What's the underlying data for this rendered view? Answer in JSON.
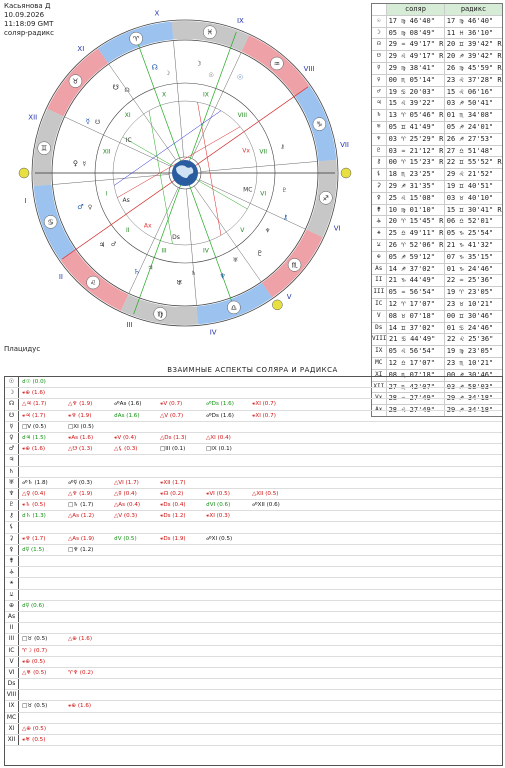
{
  "header": {
    "name": "Касьянова Д",
    "date": "10.09.2026",
    "time": "11:18:09 GMT",
    "chart_type": "соляр-радикс"
  },
  "house_system": "Плацидус",
  "colors": {
    "houses_arc_blue": "#4a90e2",
    "houses_arc_red": "#e05560",
    "houses_arc_gray": "#999999",
    "sun_marker": "#e8e040",
    "globe": "#2a5d9f"
  },
  "wheel": {
    "house_numerals_outer": [
      "I",
      "II",
      "III",
      "IV",
      "V",
      "VI",
      "VII",
      "VIII",
      "IX",
      "X",
      "XI",
      "XII",
      "Vx"
    ],
    "house_numerals_inner": [
      "I",
      "II",
      "III",
      "IV",
      "V",
      "VI",
      "VII",
      "VIII",
      "IX",
      "X",
      "XI",
      "XII"
    ],
    "axes": {
      "asc": "As",
      "ds": "Ds",
      "mc": "MC",
      "ic": "IC",
      "vx": "Vx",
      "ax": "Ax"
    },
    "zodiac_glyphs": [
      "♑",
      "♒",
      "♓",
      "♈",
      "♉",
      "♊",
      "♋",
      "♌",
      "♍",
      "♎",
      "♏",
      "♐"
    ]
  },
  "planets_table": {
    "headers": [
      "",
      "соляр",
      "радикс"
    ],
    "rows": [
      [
        "☉",
        "17 ♍ 46'40\"",
        "17 ♍ 46'40\""
      ],
      [
        "☽",
        "05 ♍ 08'49\"",
        "11 ♓ 36'10\""
      ],
      [
        "☊",
        "29 ♒ 49'17\" R",
        "20 ♊ 39'42\" R"
      ],
      [
        "☋",
        "29 ♌ 49'17\" R",
        "20 ♐ 39'42\" R"
      ],
      [
        "☿",
        "29 ♍ 38'41\"",
        "26 ♍ 45'59\" R"
      ],
      [
        "♀",
        "00 ♏ 05'14\"",
        "23 ♌ 37'28\" R"
      ],
      [
        "♂",
        "19 ♋ 20'03\"",
        "15 ♌ 06'16\""
      ],
      [
        "♃",
        "15 ♌ 39'22\"",
        "03 ♐ 50'41\""
      ],
      [
        "♄",
        "13 ♈ 05'46\" R",
        "01 ♏ 34'08\""
      ],
      [
        "♅",
        "05 ♊ 41'49\"",
        "05 ♐ 24'01\""
      ],
      [
        "♆",
        "03 ♈ 25'29\" R",
        "26 ♐ 27'53\""
      ],
      [
        "♇",
        "03 ♒ 21'12\" R",
        "27 ♎ 51'48\""
      ],
      [
        "⚷",
        "00 ♈ 15'23\" R",
        "22 ♊ 55'52\" R"
      ],
      [
        "⚸",
        "18 ♏ 23'25\"",
        "29 ♌ 21'52\""
      ],
      [
        "⚳",
        "29 ♐ 31'35\"",
        "19 ♊ 40'51\""
      ],
      [
        "⚴",
        "25 ♌ 15'08\"",
        "03 ♉ 40'10\""
      ],
      [
        "⚵",
        "10 ♍ 01'10\"",
        "15 ♊ 30'41\" R"
      ],
      [
        "⚶",
        "20 ♈ 15'45\" R",
        "06 ♎ 52'01\""
      ],
      [
        "⚹",
        "25 ♎ 49'11\" R",
        "05 ♑ 25'54\""
      ],
      [
        "⚺",
        "26 ♈ 52'06\" R",
        "21 ♑ 41'32\""
      ],
      [
        "⊕",
        "05 ♐ 59'12\"",
        "07 ♑ 35'15\""
      ],
      [
        "As",
        "14 ♐ 37'02\"",
        "01 ♑ 24'46\""
      ],
      [
        "II",
        "21 ♑ 44'49\"",
        "22 ♒ 25'36\""
      ],
      [
        "III",
        "05 ♒ 56'54\"",
        "19 ♈ 23'05\""
      ],
      [
        "IC",
        "12 ♈ 17'07\"",
        "23 ♉ 10'21\""
      ],
      [
        "V",
        "08 ♉ 07'18\"",
        "00 ♊ 30'46\""
      ],
      [
        "Ds",
        "14 ♊ 37'02\"",
        "01 ♋ 24'46\""
      ],
      [
        "VIII",
        "21 ♋ 44'49\"",
        "22 ♌ 25'36\""
      ],
      [
        "IX",
        "05 ♌ 56'54\"",
        "19 ♍ 23'05\""
      ],
      [
        "MC",
        "12 ♎ 17'07\"",
        "23 ♏ 10'21\""
      ],
      [
        "XI",
        "08 ♏ 07'18\"",
        "00 ♐ 30'46\""
      ],
      [
        "XII",
        "27 ♏ 42'07\"",
        "03 ♐ 58'03\""
      ],
      [
        "Vx",
        "28 ♒ 27'49\"",
        "29 ♐ 34'18\""
      ],
      [
        "Ax",
        "28 ♌ 27'49\"",
        "29 ♐ 34'18\""
      ]
    ]
  },
  "aspects_title": "ВЗАИМНЫЕ АСПЕКТЫ СОЛЯРА И РАДИКСА",
  "aspects": [
    {
      "label": "☉",
      "cells": [
        {
          "t": "☌☉ (0.0)",
          "c": "green"
        }
      ]
    },
    {
      "label": "☽",
      "cells": [
        {
          "t": "⚹⊕ (1.6)",
          "c": "red"
        }
      ]
    },
    {
      "label": "☊",
      "cells": [
        {
          "t": "△♃ (1.7)",
          "c": "red"
        },
        {
          "t": "△♆ (1.9)",
          "c": "red"
        },
        {
          "t": "☍As (1.6)",
          "c": "black"
        },
        {
          "t": "⚹V (0.7)",
          "c": "red"
        },
        {
          "t": "☍Ds (1.6)",
          "c": "green"
        },
        {
          "t": "⚹XI (0.7)",
          "c": "red"
        }
      ]
    },
    {
      "label": "☋",
      "cells": [
        {
          "t": "⚹♃ (1.7)",
          "c": "red"
        },
        {
          "t": "⚹♆ (1.9)",
          "c": "red"
        },
        {
          "t": "☌As (1.6)",
          "c": "green"
        },
        {
          "t": "△V (0.7)",
          "c": "red"
        },
        {
          "t": "☍Ds (1.6)",
          "c": "black"
        },
        {
          "t": "⚹XI (0.7)",
          "c": "red"
        }
      ]
    },
    {
      "label": "☿",
      "cells": [
        {
          "t": "□V (0.5)",
          "c": "black"
        },
        {
          "t": "□XI (0.5)",
          "c": "black"
        }
      ]
    },
    {
      "label": "♀",
      "cells": [
        {
          "t": "☌♃ (1.5)",
          "c": "green"
        },
        {
          "t": "⚹As (1.6)",
          "c": "red"
        },
        {
          "t": "⚹V (0.4)",
          "c": "red"
        },
        {
          "t": "△Ds (1.3)",
          "c": "red"
        },
        {
          "t": "△XI (0.4)",
          "c": "red"
        }
      ]
    },
    {
      "label": "♂",
      "cells": [
        {
          "t": "⚹⊕ (1.6)",
          "c": "red"
        },
        {
          "t": "△☋ (1.3)",
          "c": "red"
        },
        {
          "t": "△⚸ (0.3)",
          "c": "red"
        },
        {
          "t": "□III (0.1)",
          "c": "black"
        },
        {
          "t": "□IX (0.1)",
          "c": "black"
        }
      ]
    },
    {
      "label": "♃",
      "cells": []
    },
    {
      "label": "♄",
      "cells": []
    },
    {
      "label": "♅",
      "cells": [
        {
          "t": "☍♄ (1.8)",
          "c": "black"
        },
        {
          "t": "☍☿ (0.3)",
          "c": "black"
        },
        {
          "t": "△VI (1.7)",
          "c": "red"
        },
        {
          "t": "⚹XII (1.7)",
          "c": "red"
        }
      ]
    },
    {
      "label": "♆",
      "cells": [
        {
          "t": "△♀ (0.4)",
          "c": "red"
        },
        {
          "t": "△♆ (1.9)",
          "c": "red"
        },
        {
          "t": "△☿ (0.4)",
          "c": "red"
        },
        {
          "t": "⚹☊ (0.2)",
          "c": "red"
        },
        {
          "t": "⚹VI (0.5)",
          "c": "red"
        },
        {
          "t": "△XII (0.5)",
          "c": "red"
        }
      ]
    },
    {
      "label": "♇",
      "cells": [
        {
          "t": "⚹♄ (0.5)",
          "c": "red"
        },
        {
          "t": "□♄ (1.7)",
          "c": "black"
        },
        {
          "t": "△As (0.4)",
          "c": "red"
        },
        {
          "t": "⚹Ds (0.4)",
          "c": "red"
        },
        {
          "t": "☌VI (0.6)",
          "c": "green"
        },
        {
          "t": "☍XII (0.6)",
          "c": "black"
        }
      ]
    },
    {
      "label": "⚷",
      "cells": [
        {
          "t": "☌♄ (1.3)",
          "c": "green"
        },
        {
          "t": "△As (1.2)",
          "c": "red"
        },
        {
          "t": "△V (0.3)",
          "c": "red"
        },
        {
          "t": "⚹Ds (1.2)",
          "c": "red"
        },
        {
          "t": "⚹XI (0.3)",
          "c": "red"
        }
      ]
    },
    {
      "label": "⚸",
      "cells": []
    },
    {
      "label": "⚳",
      "cells": [
        {
          "t": "⚹♆ (1.7)",
          "c": "red"
        },
        {
          "t": "△As (1.9)",
          "c": "red"
        },
        {
          "t": "☌V (0.5)",
          "c": "green"
        },
        {
          "t": "⚹Ds (1.9)",
          "c": "red"
        },
        {
          "t": "☍XI (0.5)",
          "c": "black"
        }
      ]
    },
    {
      "label": "⚴",
      "cells": [
        {
          "t": "☌☿ (1.5)",
          "c": "green"
        },
        {
          "t": "□♆ (1.2)",
          "c": "black"
        }
      ]
    },
    {
      "label": "⚵",
      "cells": []
    },
    {
      "label": "⚶",
      "cells": []
    },
    {
      "label": "⚹",
      "cells": []
    },
    {
      "label": "⚺",
      "cells": []
    },
    {
      "label": "⊕",
      "cells": [
        {
          "t": "☌☿ (0.6)",
          "c": "green"
        }
      ]
    },
    {
      "label": "As",
      "cells": []
    },
    {
      "label": "II",
      "cells": []
    },
    {
      "label": "III",
      "cells": [
        {
          "t": "□♉ (0.5)",
          "c": "black"
        },
        {
          "t": "△⊕ (1.6)",
          "c": "red"
        }
      ]
    },
    {
      "label": "IC",
      "cells": [
        {
          "t": "♈☽ (0.7)",
          "c": "red"
        }
      ]
    },
    {
      "label": "V",
      "cells": [
        {
          "t": "⚹⊕ (0.5)",
          "c": "red"
        }
      ]
    },
    {
      "label": "VI",
      "cells": [
        {
          "t": "△♅ (0.5)",
          "c": "red"
        },
        {
          "t": "♈♆ (0.2)",
          "c": "red"
        }
      ]
    },
    {
      "label": "Ds",
      "cells": []
    },
    {
      "label": "VIII",
      "cells": []
    },
    {
      "label": "IX",
      "cells": [
        {
          "t": "□♉ (0.5)",
          "c": "black"
        },
        {
          "t": "⚹⊕ (1.6)",
          "c": "red"
        }
      ]
    },
    {
      "label": "MC",
      "cells": []
    },
    {
      "label": "XI",
      "cells": [
        {
          "t": "△⊕ (0.5)",
          "c": "red"
        }
      ]
    },
    {
      "label": "XII",
      "cells": [
        {
          "t": "⚹♅ (0.5)",
          "c": "red"
        }
      ]
    }
  ]
}
